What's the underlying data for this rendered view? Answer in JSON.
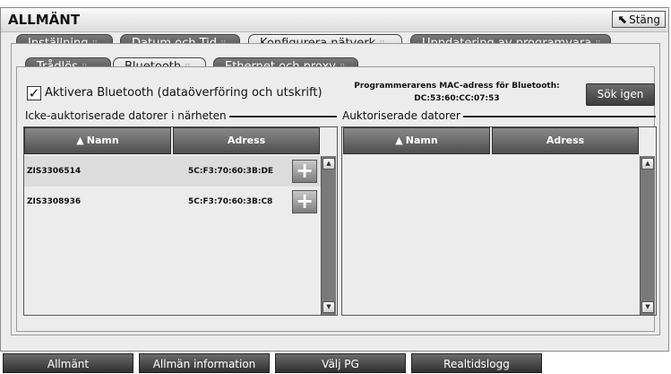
{
  "window": {
    "title": "ALLMÄNT",
    "close_label": "Stäng"
  },
  "main_tabs": [
    {
      "label": "Inställning"
    },
    {
      "label": "Datum och Tid"
    },
    {
      "label": "Konfigurera nätverk"
    },
    {
      "label": "Uppdatering av programvara"
    }
  ],
  "sub_tabs": [
    {
      "label": "Trådlös"
    },
    {
      "label": "Bluetooth"
    },
    {
      "label": "Ethernet och proxy"
    }
  ],
  "bluetooth": {
    "enable_checked": true,
    "check_mark": "✓",
    "enable_label": "Aktivera Bluetooth (dataöverföring och utskrift)",
    "mac_title": "Programmerarens MAC-adress för Bluetooth:",
    "mac_value": "DC:53:60:CC:07:53",
    "search_again_label": "Sök igen"
  },
  "unauthorized": {
    "section_label": "Icke-auktoriserade datorer i närheten",
    "col_name": "Namn",
    "col_address": "Adress",
    "rows": [
      {
        "name": "ZIS3306514",
        "address": "5C:F3:70:60:3B:DE"
      },
      {
        "name": "ZIS3308936",
        "address": "5C:F3:70:60:3B:C8"
      }
    ]
  },
  "authorized": {
    "section_label": "Auktoriserade datorer",
    "col_name": "Namn",
    "col_address": "Adress",
    "rows": []
  },
  "bottom_nav": [
    {
      "label": "Allmänt"
    },
    {
      "label": "Allmän information"
    },
    {
      "label": "Välj PG"
    },
    {
      "label": "Realtidslogg"
    }
  ],
  "icons": {
    "sort": "▲",
    "plus": "+",
    "scroll_up": "▲",
    "scroll_down": "▼",
    "close": "⬉"
  }
}
